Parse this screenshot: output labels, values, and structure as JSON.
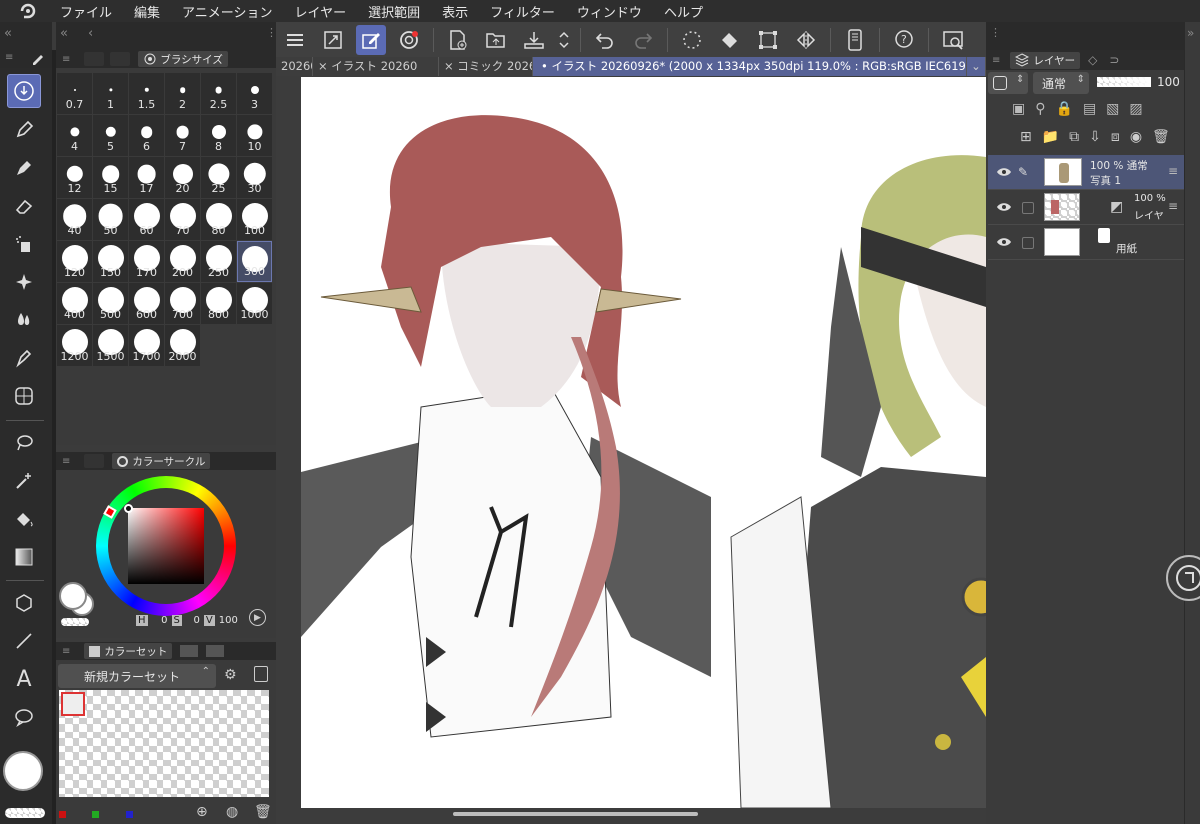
{
  "menu": {
    "items": [
      "ファイル",
      "編集",
      "アニメーション",
      "レイヤー",
      "選択範囲",
      "表示",
      "フィルター",
      "ウィンドウ",
      "ヘルプ"
    ]
  },
  "tabs": [
    {
      "label": "20260"
    },
    {
      "label": "× イラスト 20260"
    },
    {
      "label": "× コミック 20260"
    },
    {
      "label": "• イラスト 20260926* (2000 x 1334px 350dpi 119.0% : RGB:sRGB IEC61966-2.1)"
    }
  ],
  "brush_panel": {
    "title": "ブラシサイズ",
    "sizes": [
      "0.7",
      "1",
      "1.5",
      "2",
      "2.5",
      "3",
      "4",
      "5",
      "6",
      "7",
      "8",
      "10",
      "12",
      "15",
      "17",
      "20",
      "25",
      "30",
      "40",
      "50",
      "60",
      "70",
      "80",
      "100",
      "120",
      "150",
      "170",
      "200",
      "250",
      "300",
      "400",
      "500",
      "600",
      "700",
      "800",
      "1000",
      "1200",
      "1500",
      "1700",
      "2000"
    ],
    "selected": "300"
  },
  "color_panel": {
    "title": "カラーサークル",
    "h_label": "H",
    "h_value": "0",
    "s_label": "S",
    "s_value": "0",
    "v_label": "V",
    "v_value": "100"
  },
  "colorset_panel": {
    "title": "カラーセット",
    "dropdown": "新規カラーセット"
  },
  "layer_panel": {
    "title": "レイヤー",
    "blend_mode": "通常",
    "opacity": "100",
    "layers": [
      {
        "line1": "100 % 通常",
        "line2": "写真 1"
      },
      {
        "line1": "100 %",
        "line2": "レイヤ"
      },
      {
        "line1": "用紙",
        "line2": ""
      }
    ]
  },
  "colors": {
    "accent": "#5b6bb5",
    "bg": "#3b3b3b"
  }
}
